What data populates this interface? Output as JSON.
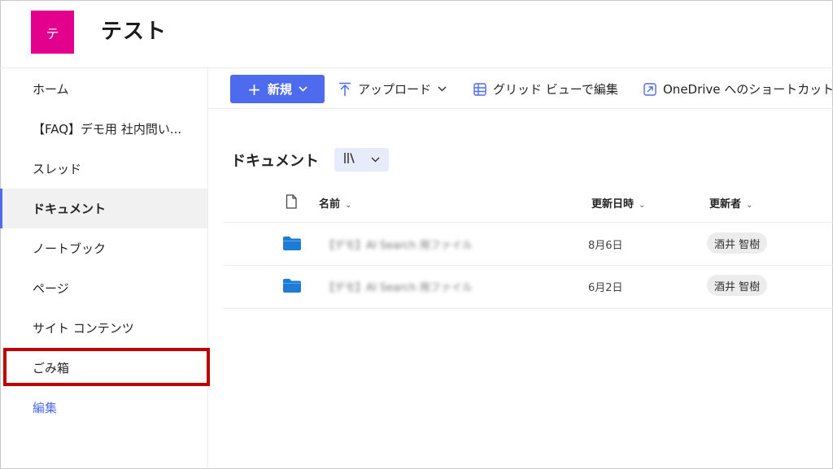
{
  "site": {
    "logo_letter": "テ",
    "title": "テスト"
  },
  "nav": {
    "items": [
      {
        "label": "ホーム"
      },
      {
        "label": "【FAQ】デモ用 社内問い..."
      },
      {
        "label": "スレッド"
      },
      {
        "label": "ドキュメント",
        "selected": true
      },
      {
        "label": "ノートブック"
      },
      {
        "label": "ページ"
      },
      {
        "label": "サイト コンテンツ"
      },
      {
        "label": "ごみ箱",
        "highlighted": true
      },
      {
        "label": "編集"
      }
    ]
  },
  "commandbar": {
    "new_label": "新規",
    "upload_label": "アップロード",
    "grid_label": "グリッド ビューで編集",
    "onedrive_label": "OneDrive へのショートカット"
  },
  "library": {
    "title": "ドキュメント",
    "columns": {
      "name": "名前",
      "modified": "更新日時",
      "modified_by": "更新者"
    },
    "rows": [
      {
        "name": "【デモ】AI Search 用ファイル",
        "modified": "8月6日",
        "modified_by": "酒井 智樹"
      },
      {
        "name": "【デモ】AI Search 用ファイル",
        "modified": "6月2日",
        "modified_by": "酒井 智樹"
      }
    ]
  },
  "colors": {
    "accent": "#4f6bed",
    "logo_bg": "#e3008c",
    "highlight_border": "#c00000",
    "folder": "#1e7bd6"
  }
}
